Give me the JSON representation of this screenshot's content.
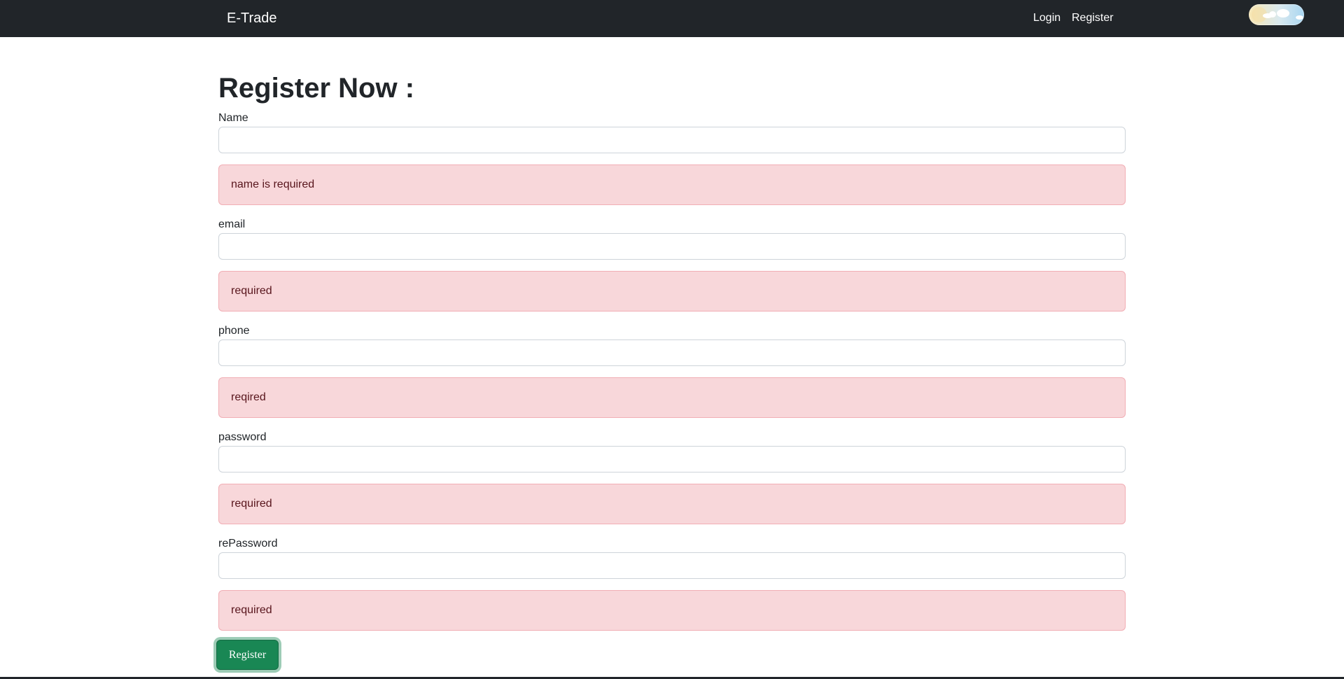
{
  "navbar": {
    "brand": "E-Trade",
    "links": [
      "Login",
      "Register"
    ],
    "theme_toggle_icon": "day-night-toggle-icon",
    "background_color": "#212529"
  },
  "page": {
    "title": "Register Now :"
  },
  "form": {
    "fields": [
      {
        "label": "Name",
        "value": "",
        "error": "name is required"
      },
      {
        "label": "email",
        "value": "",
        "error": "required"
      },
      {
        "label": "phone",
        "value": "",
        "error": "reqired"
      },
      {
        "label": "password",
        "value": "",
        "error": "required"
      },
      {
        "label": "rePassword",
        "value": "",
        "error": "required"
      }
    ],
    "submit_label": "Register",
    "submit_color": "#198754",
    "alert_color": "#f8d7da"
  }
}
